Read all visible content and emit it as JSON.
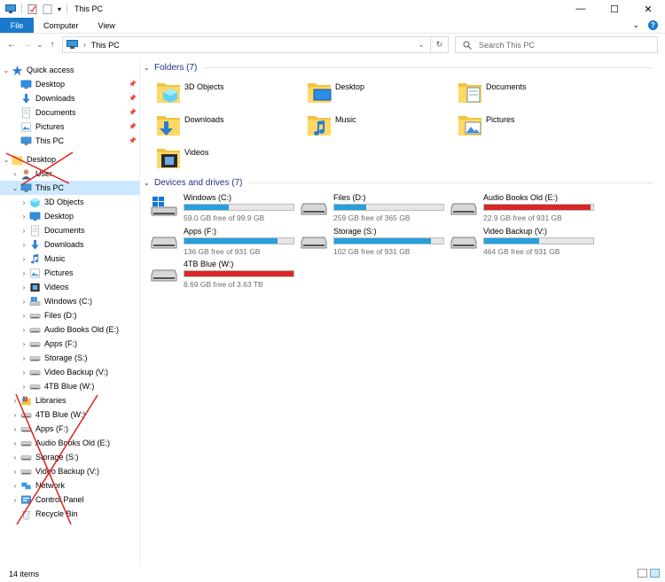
{
  "window": {
    "title": "This PC",
    "buttons": {
      "minimize": "—",
      "maximize": "☐",
      "close": "✕"
    }
  },
  "ribbon": {
    "tabs": [
      "File",
      "Computer",
      "View"
    ]
  },
  "address": {
    "crumb": "This PC",
    "search_placeholder": "Search This PC"
  },
  "nav": {
    "items": [
      {
        "label": "Quick access",
        "icon": "star-icon",
        "level": 0,
        "expanded": true
      },
      {
        "label": "Desktop",
        "icon": "desktop-icon",
        "level": 1,
        "pinned": true
      },
      {
        "label": "Downloads",
        "icon": "downloads-icon",
        "level": 1,
        "pinned": true
      },
      {
        "label": "Documents",
        "icon": "documents-icon",
        "level": 1,
        "pinned": true
      },
      {
        "label": "Pictures",
        "icon": "pictures-icon",
        "level": 1,
        "pinned": true
      },
      {
        "label": "This PC",
        "icon": "computer-icon",
        "level": 1,
        "pinned": true
      },
      {
        "label": "Desktop",
        "icon": "folder-icon",
        "level": 0,
        "expanded": true
      },
      {
        "label": "User",
        "icon": "user-icon",
        "level": 1
      },
      {
        "label": "This PC",
        "icon": "computer-icon",
        "level": 1,
        "selected": true,
        "expanded": true
      },
      {
        "label": "3D Objects",
        "icon": "objects-3d-icon",
        "level": 2
      },
      {
        "label": "Desktop",
        "icon": "desktop-icon",
        "level": 2
      },
      {
        "label": "Documents",
        "icon": "documents-icon",
        "level": 2
      },
      {
        "label": "Downloads",
        "icon": "downloads-icon",
        "level": 2
      },
      {
        "label": "Music",
        "icon": "music-icon",
        "level": 2
      },
      {
        "label": "Pictures",
        "icon": "pictures-icon",
        "level": 2
      },
      {
        "label": "Videos",
        "icon": "videos-icon",
        "level": 2
      },
      {
        "label": "Windows (C:)",
        "icon": "windows-drive-icon",
        "level": 2
      },
      {
        "label": "Files (D:)",
        "icon": "drive-icon",
        "level": 2
      },
      {
        "label": "Audio Books Old (E:)",
        "icon": "drive-icon",
        "level": 2
      },
      {
        "label": "Apps (F:)",
        "icon": "drive-icon",
        "level": 2
      },
      {
        "label": "Storage (S:)",
        "icon": "drive-icon",
        "level": 2
      },
      {
        "label": "Video Backup (V:)",
        "icon": "drive-icon",
        "level": 2
      },
      {
        "label": "4TB Blue (W:)",
        "icon": "drive-icon",
        "level": 2
      },
      {
        "label": "Libraries",
        "icon": "libraries-icon",
        "level": 1
      },
      {
        "label": "4TB Blue (W:)",
        "icon": "drive-icon",
        "level": 1
      },
      {
        "label": "Apps (F:)",
        "icon": "drive-icon",
        "level": 1
      },
      {
        "label": "Audio Books Old (E:)",
        "icon": "drive-icon",
        "level": 1
      },
      {
        "label": "Storage (S:)",
        "icon": "drive-icon",
        "level": 1
      },
      {
        "label": "Video Backup (V:)",
        "icon": "drive-icon",
        "level": 1
      },
      {
        "label": "Network",
        "icon": "network-icon",
        "level": 1
      },
      {
        "label": "Control Panel",
        "icon": "control-panel-icon",
        "level": 1
      },
      {
        "label": "Recycle Bin",
        "icon": "recycle-bin-icon",
        "level": 1
      }
    ]
  },
  "folders": {
    "header": "Folders (7)",
    "items": [
      {
        "label": "3D Objects",
        "icon": "objects-3d-icon"
      },
      {
        "label": "Desktop",
        "icon": "desktop-icon"
      },
      {
        "label": "Documents",
        "icon": "documents-icon"
      },
      {
        "label": "Downloads",
        "icon": "downloads-icon"
      },
      {
        "label": "Music",
        "icon": "music-icon"
      },
      {
        "label": "Pictures",
        "icon": "pictures-icon"
      },
      {
        "label": "Videos",
        "icon": "videos-icon"
      }
    ]
  },
  "drives": {
    "header": "Devices and drives (7)",
    "items": [
      {
        "name": "Windows (C:)",
        "free": "59.0 GB free of 99.9 GB",
        "used_fraction": 0.41,
        "warning": false,
        "icon": "windows-drive-icon"
      },
      {
        "name": "Files (D:)",
        "free": "259 GB free of 365 GB",
        "used_fraction": 0.29,
        "warning": false,
        "icon": "drive-icon"
      },
      {
        "name": "Audio Books Old (E:)",
        "free": "22.9 GB free of 931 GB",
        "used_fraction": 0.975,
        "warning": true,
        "icon": "drive-icon"
      },
      {
        "name": "Apps (F:)",
        "free": "136 GB free of 931 GB",
        "used_fraction": 0.85,
        "warning": false,
        "icon": "drive-icon"
      },
      {
        "name": "Storage (S:)",
        "free": "102 GB free of 931 GB",
        "used_fraction": 0.89,
        "warning": false,
        "icon": "drive-icon"
      },
      {
        "name": "Video Backup (V:)",
        "free": "464 GB free of 931 GB",
        "used_fraction": 0.5,
        "warning": false,
        "icon": "drive-icon"
      },
      {
        "name": "4TB Blue (W:)",
        "free": "8.69 GB free of 3.63 TB",
        "used_fraction": 0.998,
        "warning": true,
        "icon": "drive-icon"
      }
    ]
  },
  "status": {
    "item_count": "14 items"
  },
  "colors": {
    "accent": "#1979ca",
    "selection": "#cce8ff",
    "bar_normal": "#26a0da",
    "bar_full": "#da2626",
    "header_text": "#1e3287",
    "annotation_cross": "#e0201c"
  }
}
